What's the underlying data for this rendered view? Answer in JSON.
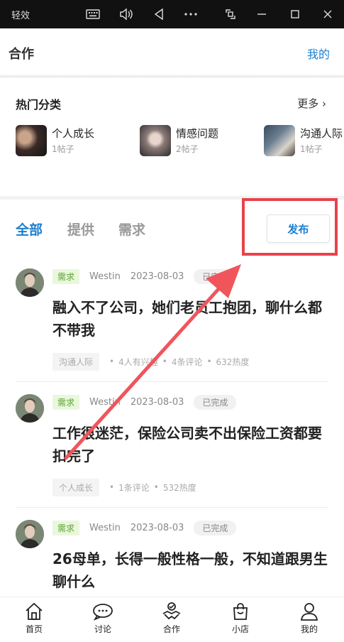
{
  "window": {
    "app_title": "轻效",
    "controls": [
      "keyboard-icon",
      "volume-icon",
      "back-icon",
      "more-icon",
      "screenshot-icon",
      "minimize-icon",
      "maximize-icon",
      "close-icon"
    ]
  },
  "header": {
    "title": "合作",
    "mine_link": "我的"
  },
  "hot": {
    "title": "热门分类",
    "more": "更多 ›",
    "categories": [
      {
        "name": "个人成长",
        "count": "1帖子"
      },
      {
        "name": "情感问题",
        "count": "2帖子"
      },
      {
        "name": "沟通人际",
        "count": "1帖子"
      }
    ]
  },
  "feed": {
    "tabs": [
      "全部",
      "提供",
      "需求"
    ],
    "active_tab": "全部",
    "publish_label": "发布",
    "posts": [
      {
        "tag": "需求",
        "author": "Westin",
        "date": "2023-08-03",
        "status": "已完成",
        "title": "融入不了公司，她们老员工抱团，聊什么都不带我",
        "category": "沟通人际",
        "interest": "4人有兴趣",
        "comments": "4条评论",
        "heat": "632热度"
      },
      {
        "tag": "需求",
        "author": "Westin",
        "date": "2023-08-03",
        "status": "已完成",
        "title": "工作很迷茫，保险公司卖不出保险工资都要扣完了",
        "category": "个人成长",
        "comments": "1条评论",
        "heat": "532热度"
      },
      {
        "tag": "需求",
        "author": "Westin",
        "date": "2023-08-03",
        "status": "已完成",
        "title": "26母单，长得一般性格一般，不知道跟男生聊什么"
      }
    ]
  },
  "bottom_nav": [
    {
      "label": "首页",
      "icon": "home-icon"
    },
    {
      "label": "讨论",
      "icon": "chat-icon"
    },
    {
      "label": "合作",
      "icon": "handshake-icon"
    },
    {
      "label": "小店",
      "icon": "bag-icon"
    },
    {
      "label": "我的",
      "icon": "user-icon"
    }
  ],
  "colors": {
    "accent": "#1a7fd0",
    "annotation_red": "#e8424a",
    "need_tag": "#5aa532"
  }
}
